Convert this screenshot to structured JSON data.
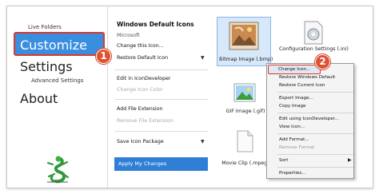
{
  "nav": {
    "live_folders": "Live Folders",
    "customize": "Customize",
    "settings": "Settings",
    "advanced_settings": "Advanced Settings",
    "about": "About"
  },
  "panel": {
    "title": "Windows Default Icons",
    "vendor": "Microsoft",
    "change_this_icon": "Change this Icon...",
    "restore_default": "Restore Default Icon",
    "edit_in_icondeveloper": "Edit in IconDeveloper",
    "change_icon_color": "Change Icon Color",
    "add_file_extension": "Add File Extension",
    "remove_file_extension": "Remove File Extension",
    "save_icon_package": "Save Icon Package",
    "apply_my_changes": "Apply My Changes"
  },
  "icons": [
    {
      "label": "Bitmap Image (.bmp)"
    },
    {
      "label": "Configuration Settings (.ini)"
    },
    {
      "label": "GIF Image (.gif)"
    },
    {
      "label": "Movie Clip (.mpeg)"
    }
  ],
  "context_menu": {
    "items": [
      {
        "label": "Change Icon...",
        "enabled": true
      },
      {
        "label": "Restore Windows Default",
        "enabled": true
      },
      {
        "label": "Restore Current Icon",
        "enabled": true
      },
      {
        "label": "Export Image...",
        "enabled": true
      },
      {
        "label": "Copy Image",
        "enabled": true
      },
      {
        "label": "Edit using IconDeveloper...",
        "enabled": true
      },
      {
        "label": "View Icon...",
        "enabled": true
      },
      {
        "label": "Add Format...",
        "enabled": true
      },
      {
        "label": "Remove Format",
        "enabled": false
      },
      {
        "label": "Sort",
        "enabled": true
      },
      {
        "label": "Properties...",
        "enabled": true
      }
    ]
  },
  "badges": {
    "first": "1",
    "second": "2"
  },
  "colors": {
    "accent": "#2f7fd6",
    "highlight_border": "#d83a2c",
    "badge": "#e0522f"
  }
}
